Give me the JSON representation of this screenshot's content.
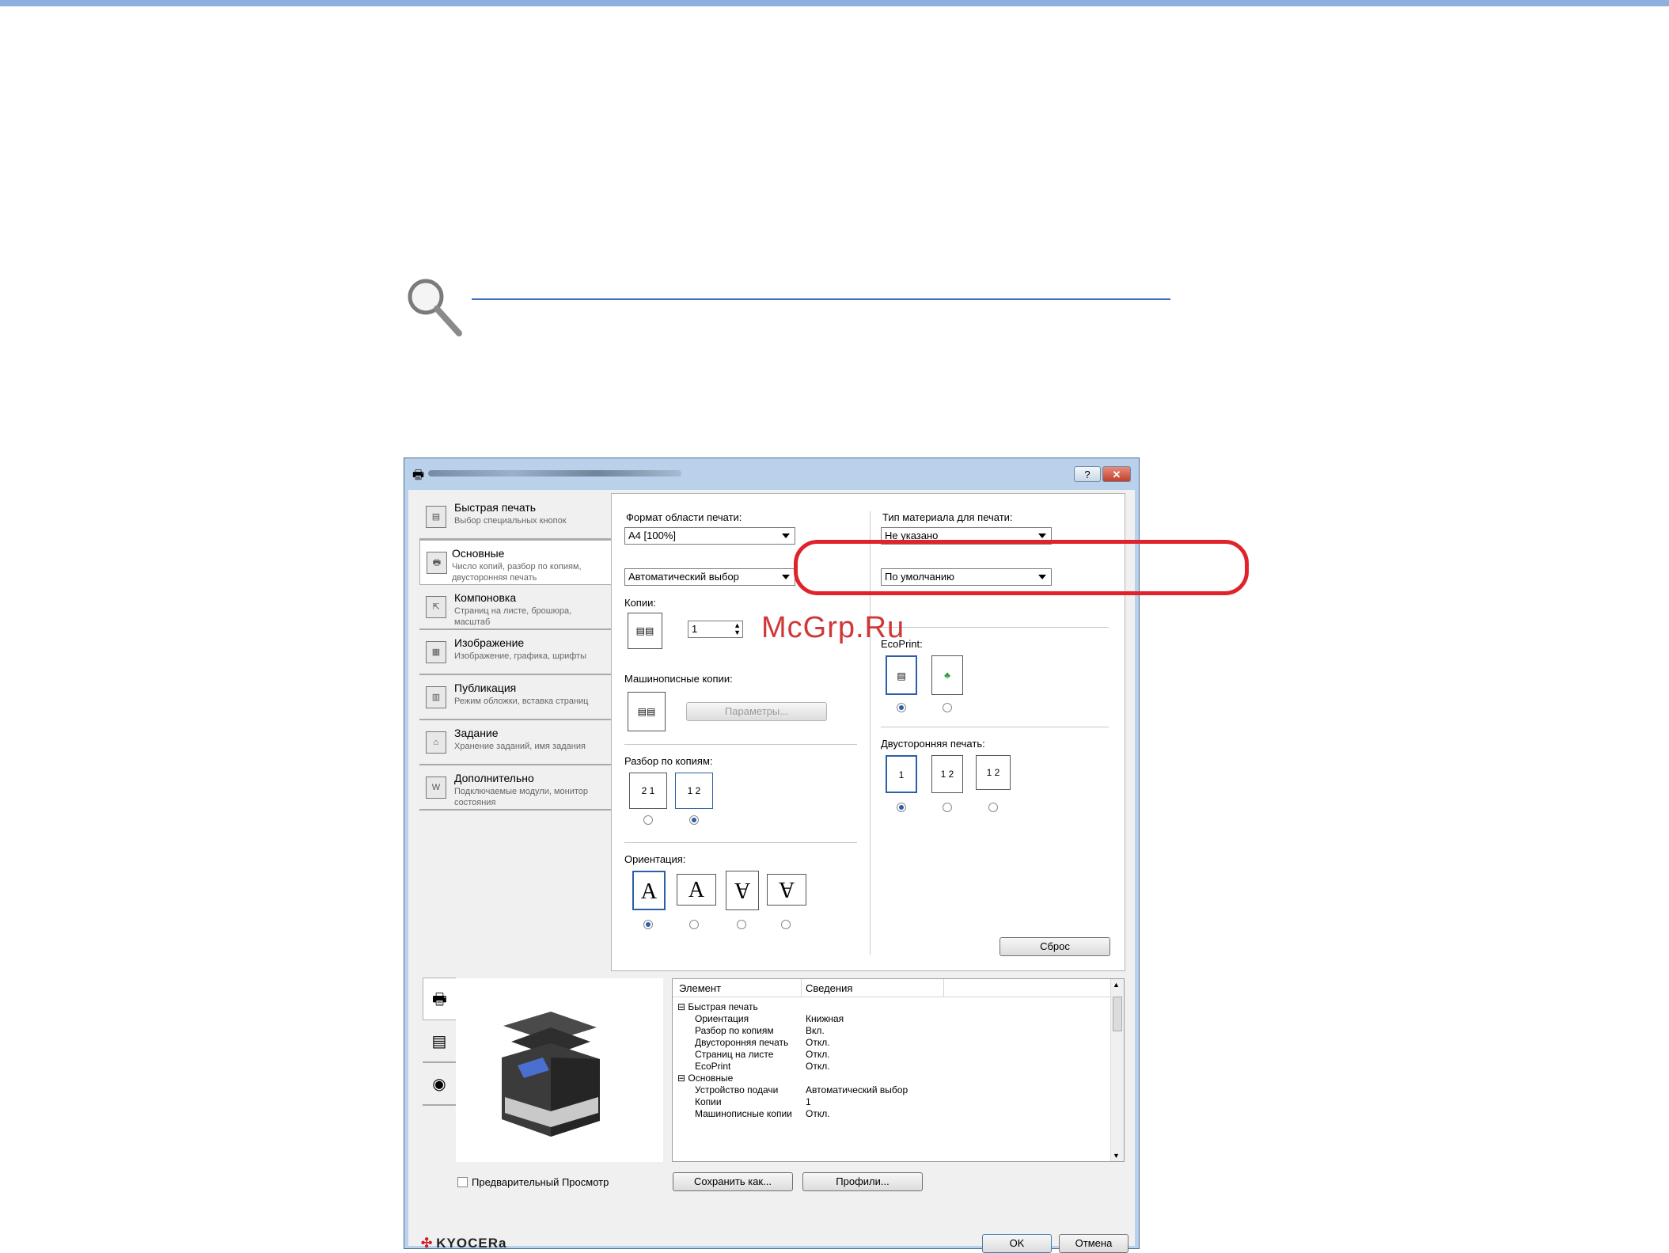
{
  "watermark": "McGrp.Ru",
  "dialog": {
    "help_label": "?",
    "close_label": "✕",
    "nav": [
      {
        "title": "Быстрая печать",
        "sub": "Выбор специальных кнопок",
        "icon": "quick-print-icon"
      },
      {
        "title": "Основные",
        "sub": "Число копий, разбор по копиям, двусторонняя печать",
        "icon": "basic-icon"
      },
      {
        "title": "Компоновка",
        "sub": "Страниц на листе, брошюра, масштаб",
        "icon": "layout-icon"
      },
      {
        "title": "Изображение",
        "sub": "Изображение, графика, шрифты",
        "icon": "image-icon"
      },
      {
        "title": "Публикация",
        "sub": "Режим обложки, вставка страниц",
        "icon": "publishing-icon"
      },
      {
        "title": "Задание",
        "sub": "Хранение заданий, имя задания",
        "icon": "job-icon"
      },
      {
        "title": "Дополнительно",
        "sub": "Подключаемые модули, монитор состояния",
        "icon": "advanced-icon"
      }
    ],
    "panel": {
      "print_size_label": "Формат области печати:",
      "print_size_value": "A4  [100%]",
      "media_type_label": "Тип материала для печати:",
      "media_type_value": "Не указано",
      "source_value": "Автоматический выбор",
      "output_value": "По умолчанию",
      "copies_label": "Копии:",
      "copies_value": "1",
      "carbon_label": "Машинописные копии:",
      "params_button": "Параметры...",
      "collate_label": "Разбор по копиям:",
      "orientation_label": "Ориентация:",
      "ecoprint_label": "EcoPrint:",
      "duplex_label": "Двусторонняя печать:",
      "reset_button": "Сброс"
    },
    "details": {
      "col_element": "Элемент",
      "col_info": "Сведения",
      "rows": [
        {
          "name": "Быстрая печать",
          "value": "",
          "group": true
        },
        {
          "name": "Ориентация",
          "value": "Книжная",
          "group": false
        },
        {
          "name": "Разбор по копиям",
          "value": "Вкл.",
          "group": false
        },
        {
          "name": "Двусторонняя печать",
          "value": "Откл.",
          "group": false
        },
        {
          "name": "Страниц на листе",
          "value": "Откл.",
          "group": false
        },
        {
          "name": "EcoPrint",
          "value": "Откл.",
          "group": false
        },
        {
          "name": "Основные",
          "value": "",
          "group": true
        },
        {
          "name": "Устройство подачи",
          "value": "Автоматический выбор",
          "group": false
        },
        {
          "name": "Копии",
          "value": "1",
          "group": false
        },
        {
          "name": "Машинописные копии",
          "value": "Откл.",
          "group": false
        }
      ]
    },
    "preview_checkbox": "Предварительный Просмотр",
    "save_as_button": "Сохранить как...",
    "profiles_button": "Профили...",
    "ok_button": "OK",
    "cancel_button": "Отмена",
    "brand": "KYOCERa"
  }
}
